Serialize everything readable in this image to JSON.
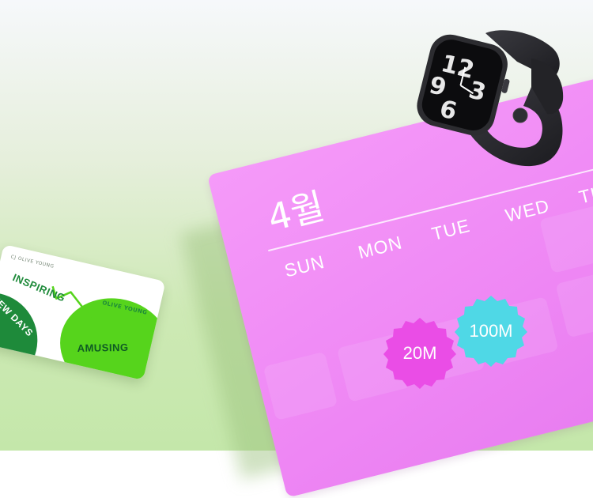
{
  "gift_card": {
    "issuer_label": "CJ OLIVE YOUNG",
    "brand": "OLIVE YOUNG",
    "words": [
      "INSPIRING",
      "NEW DAYS",
      "AMUSING"
    ]
  },
  "calendar": {
    "month": "4월",
    "weekdays": [
      "SUN",
      "MON",
      "TUE",
      "WED",
      "TH"
    ]
  },
  "badges": [
    {
      "label": "20M",
      "color": "#ea4de6"
    },
    {
      "label": "100M",
      "color": "#4fd8e6"
    }
  ],
  "watch": {
    "dial_numbers": [
      "12",
      "3",
      "6",
      "9"
    ],
    "case_color": "#2c2c30"
  },
  "colors": {
    "calendar_pink": "#f08cf6",
    "card_green": "#1e8a3a",
    "card_lime": "#56d41c"
  }
}
